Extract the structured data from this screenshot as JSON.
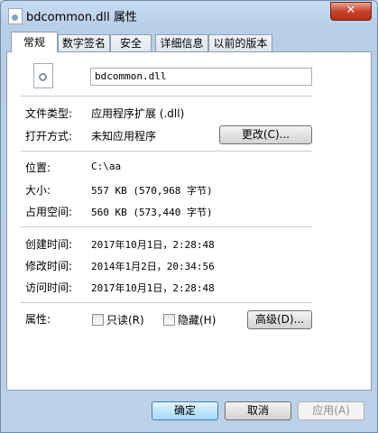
{
  "window": {
    "title": "bdcommon.dll 属性",
    "close_label": "✕"
  },
  "tabs": [
    {
      "label": "常规",
      "active": true
    },
    {
      "label": "数字签名",
      "active": false
    },
    {
      "label": "安全",
      "active": false
    },
    {
      "label": "详细信息",
      "active": false
    },
    {
      "label": "以前的版本",
      "active": false
    }
  ],
  "general": {
    "file_name": "bdcommon.dll",
    "file_type_label": "文件类型:",
    "file_type_value": "应用程序扩展 (.dll)",
    "open_with_label": "打开方式:",
    "open_with_value": "未知应用程序",
    "change_button": "更改(C)...",
    "location_label": "位置:",
    "location_value": "C:\\aa",
    "size_label": "大小:",
    "size_value": "557 KB (570,968 字节)",
    "disk_size_label": "占用空间:",
    "disk_size_value": "560 KB (573,440 字节)",
    "created_label": "创建时间:",
    "created_value": "2017年10月1日，2:28:48",
    "modified_label": "修改时间:",
    "modified_value": "2014年1月2日，20:34:56",
    "accessed_label": "访问时间:",
    "accessed_value": "2017年10月1日，2:28:48",
    "attributes_label": "属性:",
    "readonly_label": "只读(R)",
    "hidden_label": "隐藏(H)",
    "advanced_button": "高级(D)..."
  },
  "footer": {
    "ok": "确定",
    "cancel": "取消",
    "apply": "应用(A)"
  }
}
